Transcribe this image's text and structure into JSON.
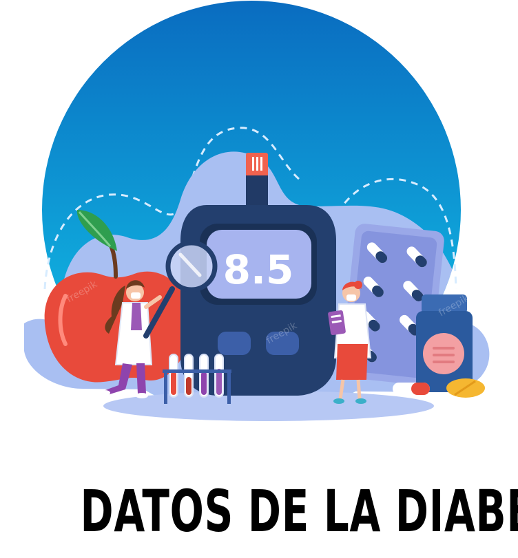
{
  "title": "DATOS DE LA DIABETES",
  "meter": {
    "reading": "8.5"
  },
  "watermark": "freepik",
  "icons": {
    "meter": "glucose-meter-icon",
    "apple": "apple-icon",
    "magnifier": "magnifying-glass-icon",
    "test_tubes": "test-tube-rack-icon",
    "pill_blister": "pill-blister-pack-icon",
    "pill_bottle": "pill-bottle-icon",
    "pills": "pills-icon",
    "doctor_left": "doctor-with-magnifier-icon",
    "doctor_right": "doctor-with-clipboard-icon"
  },
  "colors": {
    "circle_top": "#0a6fc2",
    "circle_bottom": "#12c6e8",
    "blob": "#a8bdf0",
    "meter_body": "#233f6e",
    "meter_screen": "#a7b4ef",
    "apple": "#e8463a",
    "leaf": "#2f9e4f",
    "title": "#000000"
  }
}
